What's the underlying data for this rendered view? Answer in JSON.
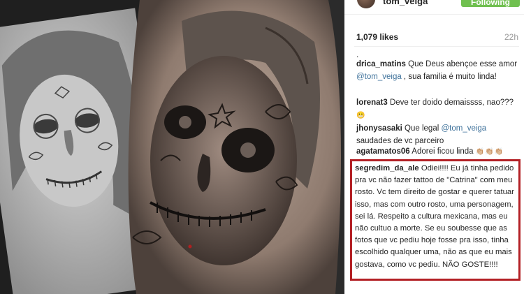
{
  "header": {
    "username": "tom_veiga",
    "follow_label": "Following"
  },
  "post": {
    "likes": "1,079 likes",
    "time": "22h",
    "dot": "."
  },
  "comments": [
    {
      "user": "drica_matins",
      "pre": " Que Deus abençoe esse amor ",
      "mention": "@tom_veiga",
      "post": " , sua familia é muito linda!"
    },
    {
      "user": "lorenat3",
      "text": " Deve ter doido demaissss, nao???",
      "emoji": "😬"
    },
    {
      "user": "jhonysasaki",
      "pre": " Que legal ",
      "mention": "@tom_veiga",
      "post": " saudades de vc parceiro"
    },
    {
      "user": "agatamatos06",
      "text": " Adorei ficou linda ",
      "emoji": "👏🏼👏🏼👏🏼"
    }
  ],
  "highlighted_comment": {
    "user": "segredim_da_ale",
    "text": " Odiei!!!! Eu já tinha pedido pra vc não fazer tattoo de \"Catrina\" com meu rosto. Vc tem direito de gostar e querer tatuar isso, mas com outro rosto, uma personagem, sei lá. Respeito a cultura mexicana, mas eu não cultuo a morte. Se eu soubesse que as fotos que vc pediu hoje fosse pra isso, tinha escolhido qualquer uma, não as que eu mais gostava, como vc pediu. NÃO GOSTE!!!!"
  },
  "colors": {
    "follow_green": "#70c050",
    "highlight_red": "#b32025",
    "mention_blue": "#3f729b"
  }
}
